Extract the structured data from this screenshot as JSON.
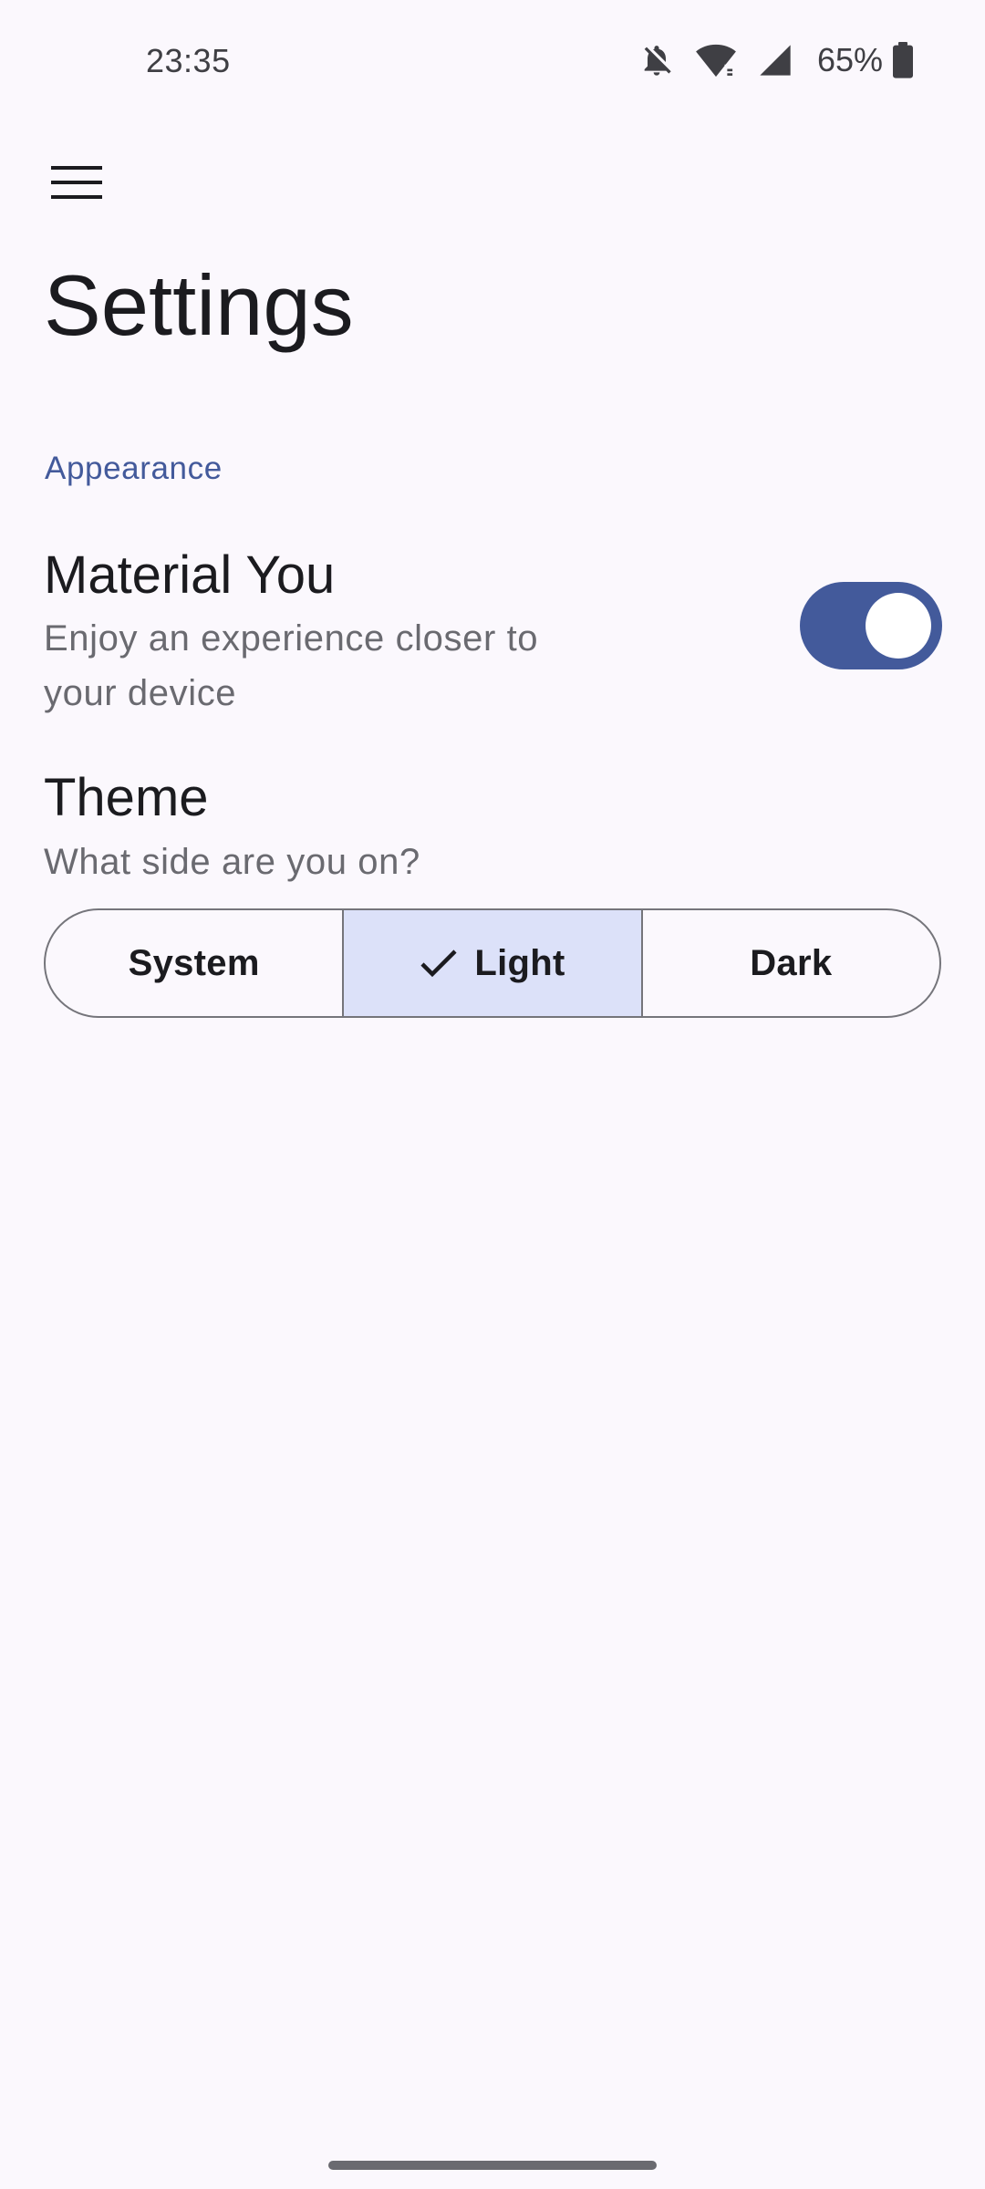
{
  "status_bar": {
    "time": "23:35",
    "battery_percent": "65%",
    "icons": [
      "bell-off-icon",
      "wifi-icon",
      "cell-signal-icon",
      "battery-icon"
    ]
  },
  "app_bar": {
    "menu_icon": "hamburger-menu-icon",
    "title": "Settings"
  },
  "appearance": {
    "header": "Appearance",
    "material_you": {
      "title": "Material You",
      "subtitle": "Enjoy an experience closer to your device",
      "enabled": true
    },
    "theme": {
      "title": "Theme",
      "subtitle": "What side are you on?",
      "options": [
        "System",
        "Light",
        "Dark"
      ],
      "selected": "Light"
    }
  },
  "colors": {
    "accent": "#435a9b",
    "selected_segment": "#dce1f9",
    "background": "#fbf8fd"
  }
}
